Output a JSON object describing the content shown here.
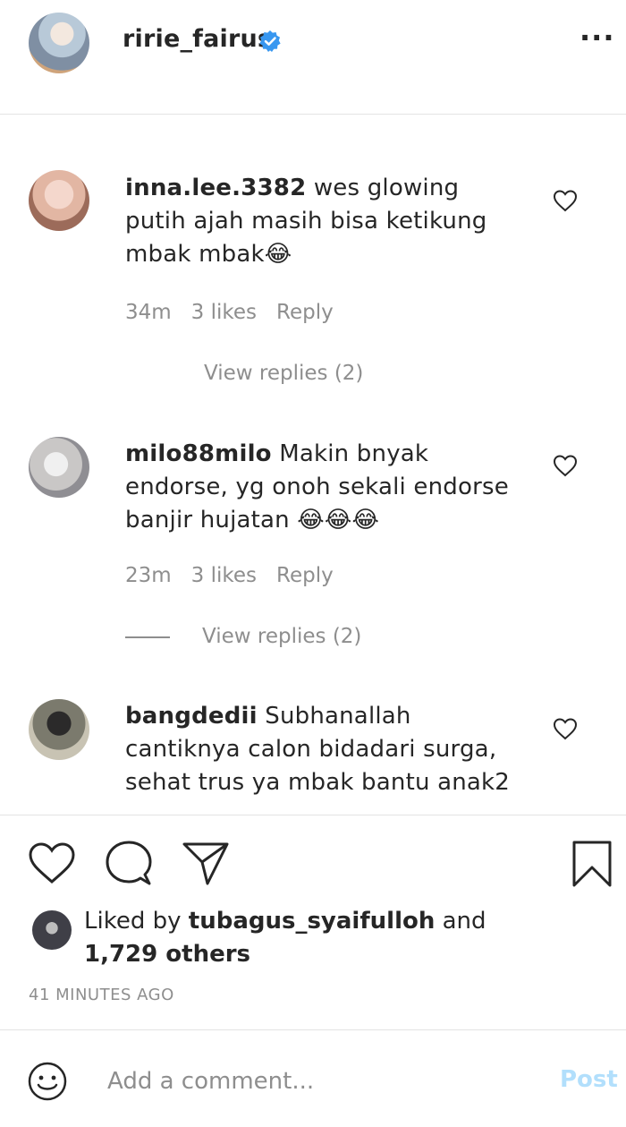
{
  "header": {
    "username": "ririe_fairus",
    "more_label": "···"
  },
  "comments": [
    {
      "username": "inna.lee.3382",
      "text": "wes glowing putih ajah masih bisa ketikung mbak mbak😂",
      "time": "34m",
      "likes": "3 likes",
      "reply": "Reply",
      "view_replies": "View replies (2)"
    },
    {
      "username": "milo88milo",
      "text": "Makin bnyak endorse, yg onoh sekali endorse banjir hujatan 😂😂😂",
      "time": "23m",
      "likes": "3 likes",
      "reply": "Reply",
      "view_replies": "View replies (2)"
    },
    {
      "username": "bangdedii",
      "text": "Subhanallah cantiknya calon bidadari surga, sehat trus ya mbak bantu anak2"
    }
  ],
  "post": {
    "liked_by_prefix": "Liked by",
    "liked_by_user": "tubagus_syaifulloh",
    "liked_by_and": "and",
    "liked_by_others": "1,729 others",
    "timestamp": "41 MINUTES AGO"
  },
  "add_comment": {
    "placeholder": "Add a comment...",
    "post_label": "Post"
  },
  "colors": {
    "verified": "#3897f0",
    "muted": "#8e8e8e",
    "post_disabled": "#b2dffc"
  }
}
